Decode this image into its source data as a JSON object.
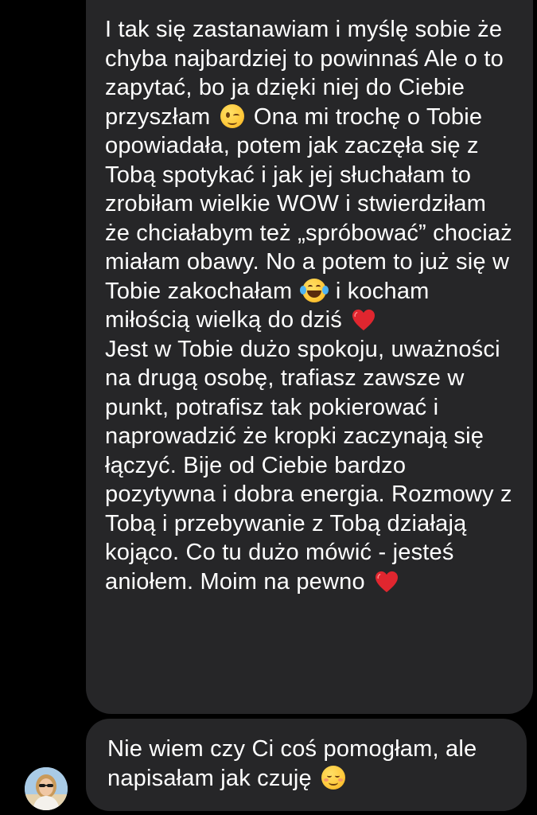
{
  "messages": [
    {
      "id": "msg-1",
      "segments": [
        {
          "type": "text",
          "value": "I tak się zastanawiam i myślę sobie że chyba najbardziej to powinnaś Ale o to zapytać, bo ja dzięki niej do Ciebie przyszłam"
        },
        {
          "type": "emoji",
          "icon": "winking-face-emoji"
        },
        {
          "type": "text",
          "value": "Ona mi trochę o Tobie opowiadała, potem jak zaczęła się z Tobą spotykać i jak jej słuchałam to zrobiłam wielkie WOW i stwierdziłam że chciałabym też „spróbować” chociaż miałam obawy. No a potem to już się w Tobie zakochałam"
        },
        {
          "type": "emoji",
          "icon": "face-with-tears-of-joy-emoji"
        },
        {
          "type": "text",
          "value": "i kocham miłością wielką do dziś"
        },
        {
          "type": "emoji",
          "icon": "red-heart-emoji"
        },
        {
          "type": "break"
        },
        {
          "type": "text",
          "value": "Jest w Tobie dużo spokoju, uważności na drugą osobę, trafiasz zawsze w punkt, potrafisz tak pokierować i naprowadzić że kropki zaczynają się łączyć. Bije od Ciebie bardzo pozytywna i dobra energia. Rozmowy z Tobą i przebywanie z Tobą działają kojąco. Co tu dużo mówić - jesteś aniołem. Moim na pewno"
        },
        {
          "type": "emoji",
          "icon": "red-heart-emoji"
        }
      ]
    },
    {
      "id": "msg-2",
      "segments": [
        {
          "type": "text",
          "value": "Nie wiem czy Ci coś pomogłam, ale napisałam jak czuję"
        },
        {
          "type": "emoji",
          "icon": "smiling-face-emoji"
        }
      ]
    }
  ],
  "sender": {
    "avatar_icon": "sender-avatar"
  },
  "colors": {
    "background": "#000000",
    "bubble": "#262628",
    "text": "#ffffff",
    "heart": "#e0262f"
  }
}
